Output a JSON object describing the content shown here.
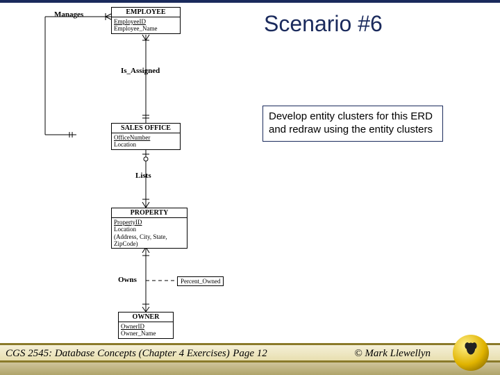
{
  "title": "Scenario #6",
  "instruction": "Develop entity clusters for this ERD and redraw using the entity clusters",
  "erd": {
    "entities": {
      "employee": {
        "name": "EMPLOYEE",
        "pk": "EmployeeID",
        "attrs": "Employee_Name"
      },
      "sales_office": {
        "name": "SALES OFFICE",
        "pk": "OfficeNumber",
        "attrs": "Location"
      },
      "property": {
        "name": "PROPERTY",
        "pk": "PropertyID",
        "attrs": "Location\n(Address, City, State,\nZipCode)"
      },
      "owner": {
        "name": "OWNER",
        "pk": "OwnerID",
        "attrs": "Owner_Name"
      }
    },
    "relationships": {
      "manages": "Manages",
      "is_assigned": "Is_Assigned",
      "lists": "Lists",
      "owns": "Owns"
    },
    "assoc_attr": "Percent_Owned"
  },
  "footer": {
    "left": "CGS 2545: Database Concepts  (Chapter 4 Exercises)",
    "center": "Page 12",
    "right": "© Mark Llewellyn"
  }
}
